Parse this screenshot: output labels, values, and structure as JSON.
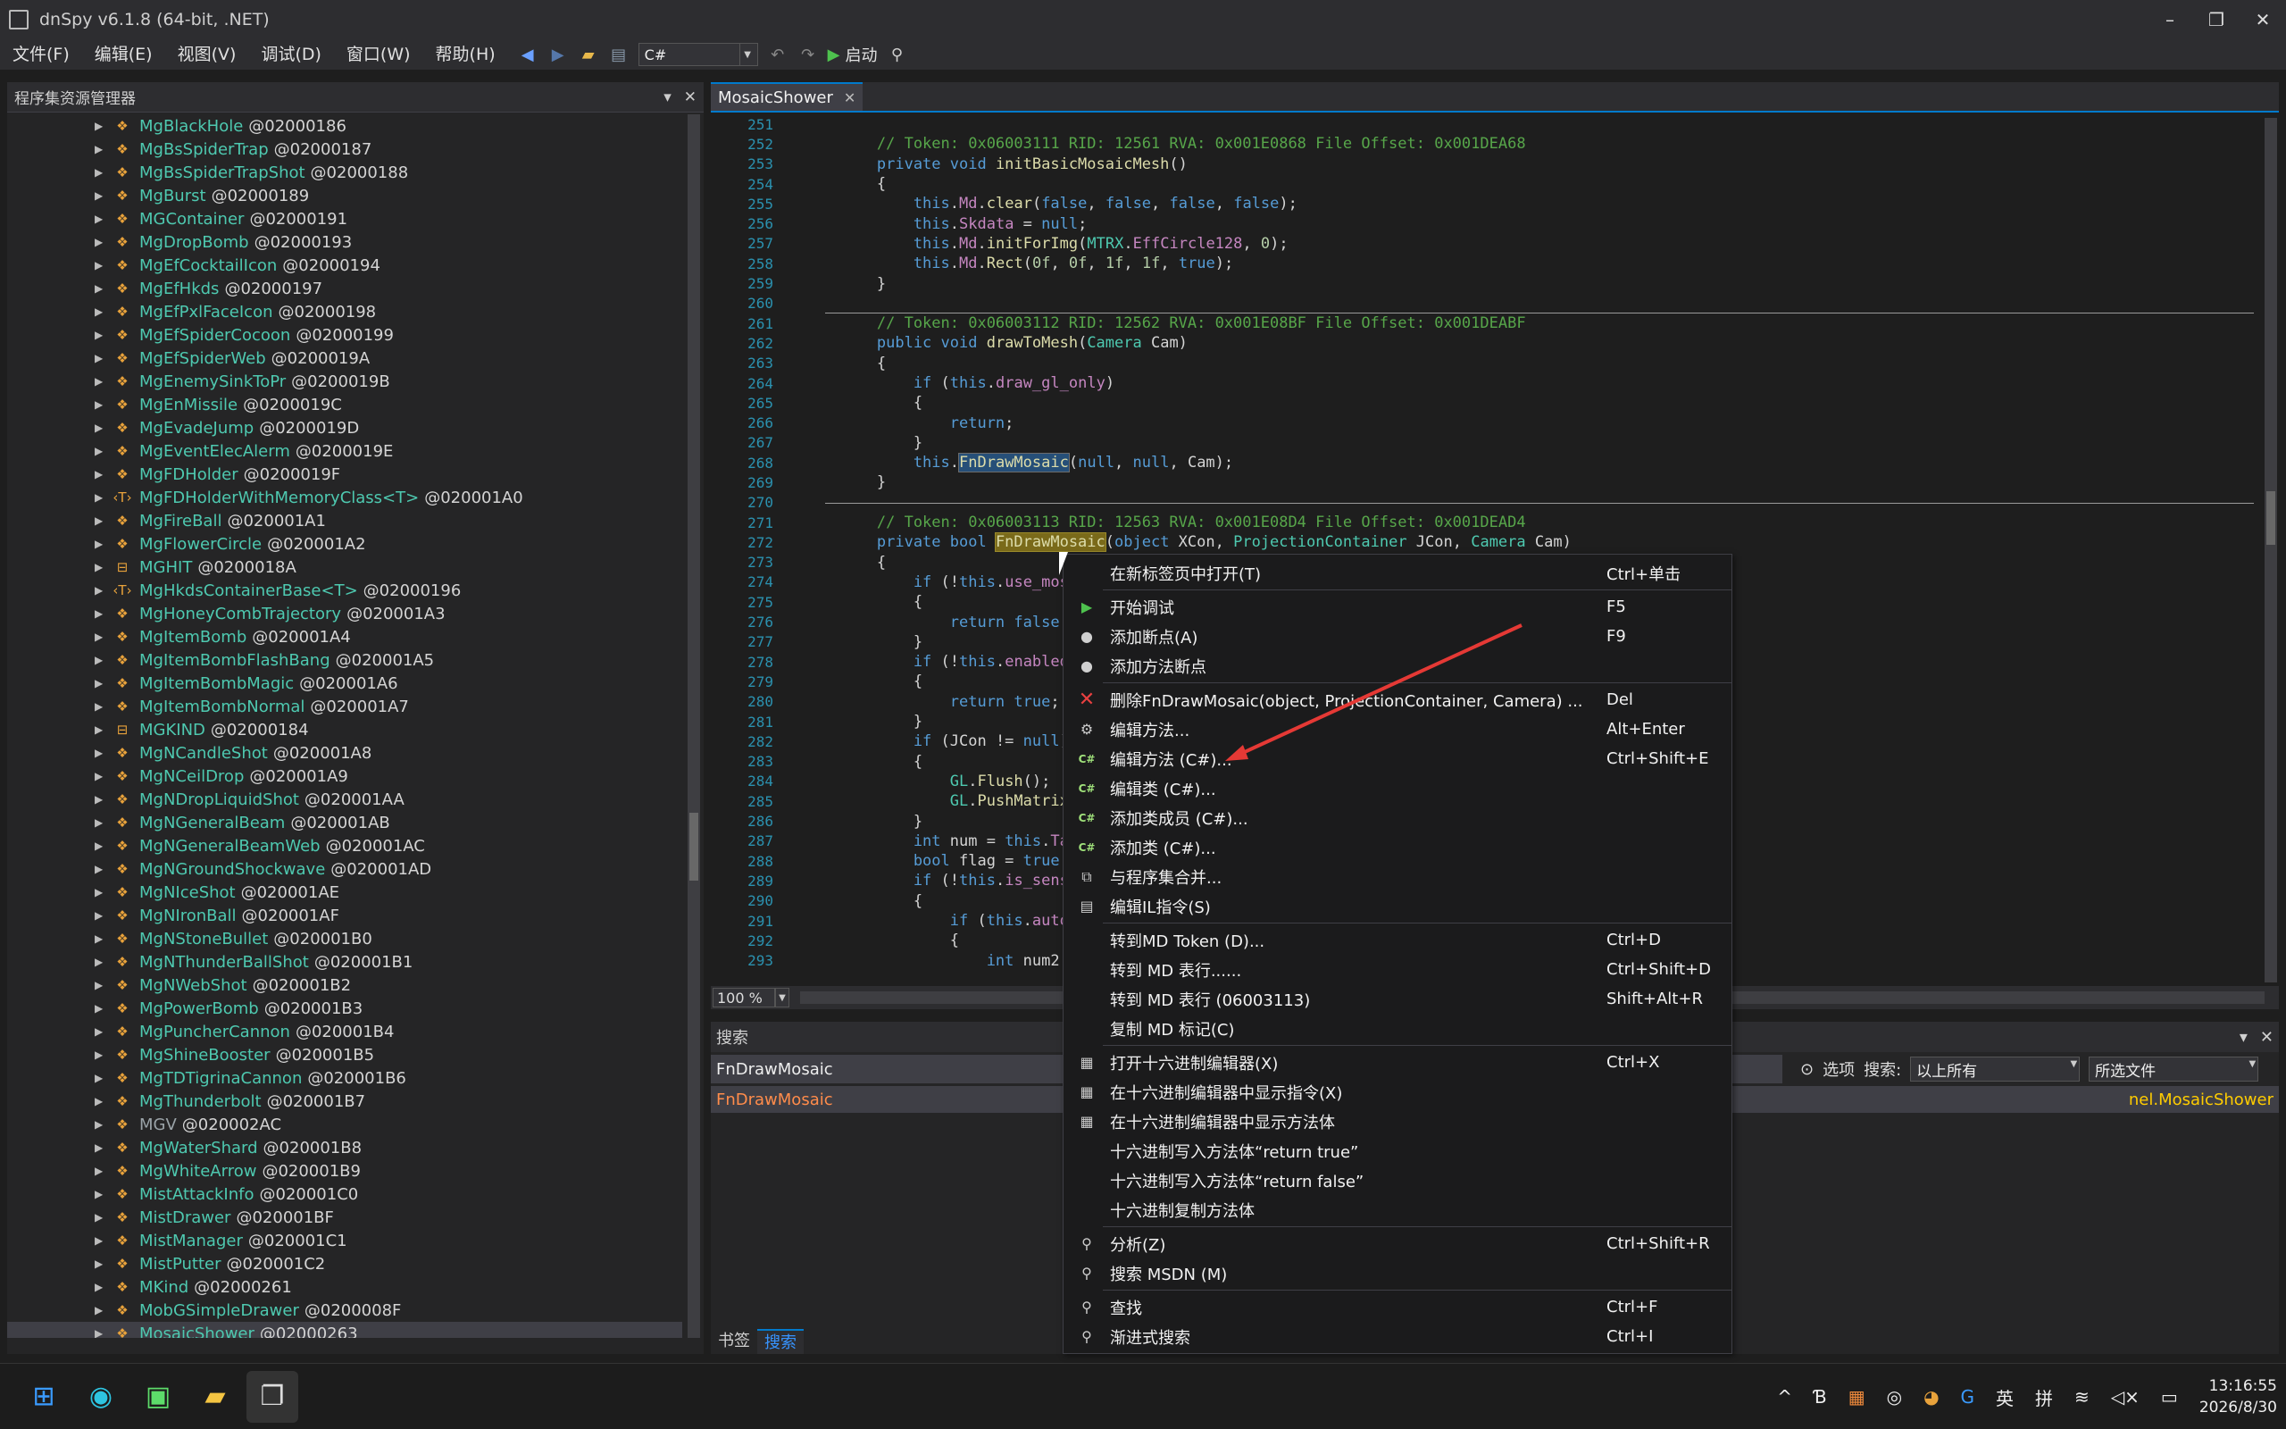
{
  "window": {
    "title": "dnSpy v6.1.8 (64-bit, .NET)",
    "minimize": "–",
    "restore": "❐",
    "close": "✕"
  },
  "menu": [
    "文件(F)",
    "编辑(E)",
    "视图(V)",
    "调试(D)",
    "窗口(W)",
    "帮助(H)"
  ],
  "toolbar": {
    "language": "C#",
    "start_label": "启动"
  },
  "assembly_explorer": {
    "title": "程序集资源管理器",
    "items": [
      {
        "name": "MgBlackHole",
        "token": "@02000186"
      },
      {
        "name": "MgBsSpiderTrap",
        "token": "@02000187"
      },
      {
        "name": "MgBsSpiderTrapShot",
        "token": "@02000188"
      },
      {
        "name": "MgBurst",
        "token": "@02000189"
      },
      {
        "name": "MGContainer",
        "token": "@02000191"
      },
      {
        "name": "MgDropBomb",
        "token": "@02000193"
      },
      {
        "name": "MgEfCocktailIcon",
        "token": "@02000194"
      },
      {
        "name": "MgEfHkds",
        "token": "@02000197"
      },
      {
        "name": "MgEfPxlFaceIcon",
        "token": "@02000198"
      },
      {
        "name": "MgEfSpiderCocoon",
        "token": "@02000199"
      },
      {
        "name": "MgEfSpiderWeb",
        "token": "@0200019A"
      },
      {
        "name": "MgEnemySinkToPr",
        "token": "@0200019B"
      },
      {
        "name": "MgEnMissile",
        "token": "@0200019C"
      },
      {
        "name": "MgEvadeJump",
        "token": "@0200019D"
      },
      {
        "name": "MgEventElecAlerm",
        "token": "@0200019E"
      },
      {
        "name": "MgFDHolder",
        "token": "@0200019F"
      },
      {
        "name": "MgFDHolderWithMemoryClass<T>",
        "token": "@020001A0"
      },
      {
        "name": "MgFireBall",
        "token": "@020001A1"
      },
      {
        "name": "MgFlowerCircle",
        "token": "@020001A2"
      },
      {
        "name": "MGHIT",
        "token": "@0200018A"
      },
      {
        "name": "MgHkdsContainerBase<T>",
        "token": "@02000196"
      },
      {
        "name": "MgHoneyCombTrajectory",
        "token": "@020001A3"
      },
      {
        "name": "MgItemBomb",
        "token": "@020001A4"
      },
      {
        "name": "MgItemBombFlashBang",
        "token": "@020001A5"
      },
      {
        "name": "MgItemBombMagic",
        "token": "@020001A6"
      },
      {
        "name": "MgItemBombNormal",
        "token": "@020001A7"
      },
      {
        "name": "MGKIND",
        "token": "@02000184"
      },
      {
        "name": "MgNCandleShot",
        "token": "@020001A8"
      },
      {
        "name": "MgNCeilDrop",
        "token": "@020001A9"
      },
      {
        "name": "MgNDropLiquidShot",
        "token": "@020001AA"
      },
      {
        "name": "MgNGeneralBeam",
        "token": "@020001AB"
      },
      {
        "name": "MgNGeneralBeamWeb",
        "token": "@020001AC"
      },
      {
        "name": "MgNGroundShockwave",
        "token": "@020001AD"
      },
      {
        "name": "MgNIceShot",
        "token": "@020001AE"
      },
      {
        "name": "MgNIronBall",
        "token": "@020001AF"
      },
      {
        "name": "MgNStoneBullet",
        "token": "@020001B0"
      },
      {
        "name": "MgNThunderBallShot",
        "token": "@020001B1"
      },
      {
        "name": "MgNWebShot",
        "token": "@020001B2"
      },
      {
        "name": "MgPowerBomb",
        "token": "@020001B3"
      },
      {
        "name": "MgPuncherCannon",
        "token": "@020001B4"
      },
      {
        "name": "MgShineBooster",
        "token": "@020001B5"
      },
      {
        "name": "MgTDTigrinaCannon",
        "token": "@020001B6"
      },
      {
        "name": "MgThunderbolt",
        "token": "@020001B7"
      },
      {
        "name": "MGV",
        "token": "@020002AC"
      },
      {
        "name": "MgWaterShard",
        "token": "@020001B8"
      },
      {
        "name": "MgWhiteArrow",
        "token": "@020001B9"
      },
      {
        "name": "MistAttackInfo",
        "token": "@020001C0"
      },
      {
        "name": "MistDrawer",
        "token": "@020001BF"
      },
      {
        "name": "MistManager",
        "token": "@020001C1"
      },
      {
        "name": "MistPutter",
        "token": "@020001C2"
      },
      {
        "name": "MKind",
        "token": "@02000261"
      },
      {
        "name": "MobGSimpleDrawer",
        "token": "@0200008F"
      },
      {
        "name": "MosaicShower",
        "token": "@02000263"
      }
    ]
  },
  "editor": {
    "tab": "MosaicShower",
    "zoom": "100 %"
  },
  "search": {
    "title": "搜索",
    "query": "FnDrawMosaic",
    "options_label": "选项",
    "search_label": "搜索:",
    "scope": "以上所有",
    "files": "所选文件",
    "result_name": "FnDrawMosaic",
    "result_type": "nel.MosaicShower"
  },
  "bottom_tabs": [
    "书签",
    "搜索"
  ],
  "context_menu": [
    {
      "label": "在新标签页中打开(T)",
      "shortcut": "Ctrl+单击",
      "icon": ""
    },
    {
      "sep": true
    },
    {
      "label": "开始调试",
      "shortcut": "F5",
      "icon": "play"
    },
    {
      "label": "添加断点(A)",
      "shortcut": "F9",
      "icon": "dot"
    },
    {
      "label": "添加方法断点",
      "shortcut": "",
      "icon": "dot"
    },
    {
      "sep": true
    },
    {
      "label": "删除FnDrawMosaic(object, ProjectionContainer, Camera) ...",
      "shortcut": "Del",
      "icon": "x"
    },
    {
      "label": "编辑方法...",
      "shortcut": "Alt+Enter",
      "icon": "gear"
    },
    {
      "label": "编辑方法 (C#)...",
      "shortcut": "Ctrl+Shift+E",
      "icon": "cs"
    },
    {
      "label": "编辑类 (C#)...",
      "shortcut": "",
      "icon": "cs"
    },
    {
      "label": "添加类成员 (C#)...",
      "shortcut": "",
      "icon": "cs"
    },
    {
      "label": "添加类 (C#)...",
      "shortcut": "",
      "icon": "cs"
    },
    {
      "label": "与程序集合并...",
      "shortcut": "",
      "icon": "merge"
    },
    {
      "label": "编辑IL指令(S)",
      "shortcut": "",
      "icon": "doc"
    },
    {
      "sep": true
    },
    {
      "label": "转到MD Token (D)...",
      "shortcut": "Ctrl+D",
      "icon": ""
    },
    {
      "label": "转到 MD 表行......",
      "shortcut": "Ctrl+Shift+D",
      "icon": ""
    },
    {
      "label": "转到 MD 表行 (06003113)",
      "shortcut": "Shift+Alt+R",
      "icon": ""
    },
    {
      "label": "复制 MD 标记(C)",
      "shortcut": "",
      "icon": ""
    },
    {
      "sep": true
    },
    {
      "label": "打开十六进制编辑器(X)",
      "shortcut": "Ctrl+X",
      "icon": "hex"
    },
    {
      "label": "在十六进制编辑器中显示指令(X)",
      "shortcut": "",
      "icon": "hex"
    },
    {
      "label": "在十六进制编辑器中显示方法体",
      "shortcut": "",
      "icon": "hex"
    },
    {
      "label": "十六进制写入方法体“return true”",
      "shortcut": "",
      "icon": ""
    },
    {
      "label": "十六进制写入方法体“return false”",
      "shortcut": "",
      "icon": ""
    },
    {
      "label": "十六进制复制方法体",
      "shortcut": "",
      "icon": ""
    },
    {
      "sep": true
    },
    {
      "label": "分析(Z)",
      "shortcut": "Ctrl+Shift+R",
      "icon": "search"
    },
    {
      "label": "搜索 MSDN (M)",
      "shortcut": "",
      "icon": "search"
    },
    {
      "sep": true
    },
    {
      "label": "查找",
      "shortcut": "Ctrl+F",
      "icon": "search"
    },
    {
      "label": "渐进式搜索",
      "shortcut": "Ctrl+I",
      "icon": "search"
    }
  ],
  "taskbar": {
    "ime1": "英",
    "ime2": "拼",
    "time": "13:16:55",
    "date": "2026/8/30"
  },
  "colors": {
    "accent": "#007acc",
    "type_color": "#4ec9b0",
    "comment": "#57a64a",
    "keyword": "#569cd6"
  }
}
